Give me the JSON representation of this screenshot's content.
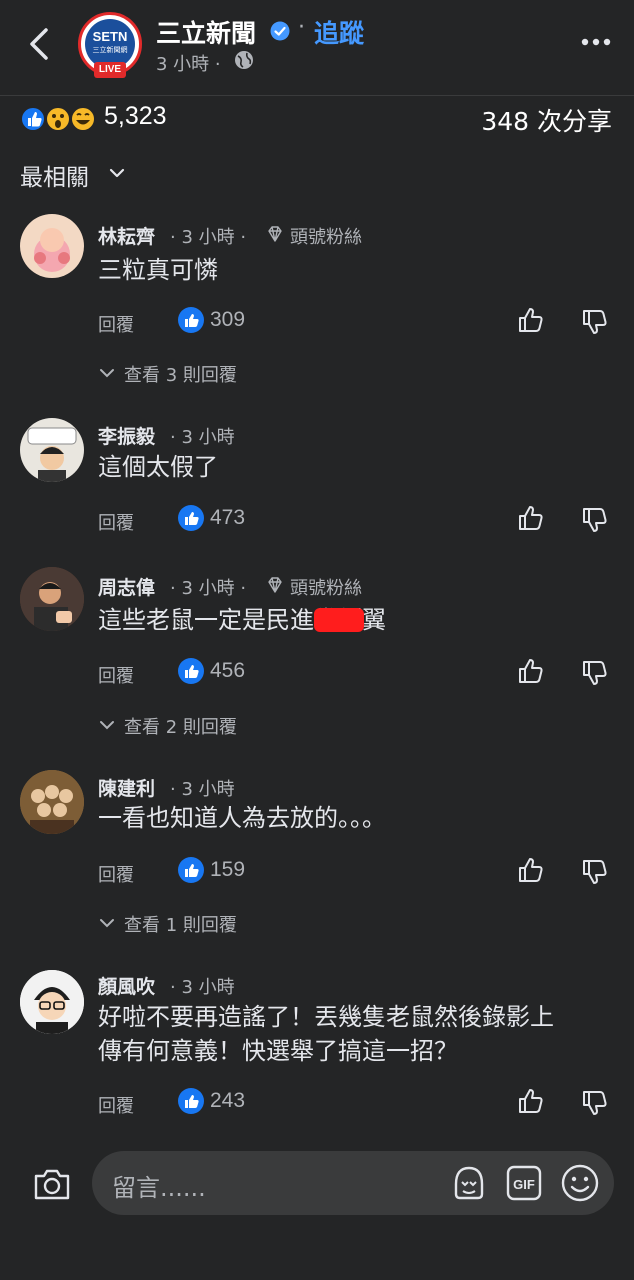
{
  "header": {
    "page_name": "三立新聞",
    "logo_text": "SETN",
    "logo_sub": "三立新聞網",
    "live_badge": "LIVE",
    "separator": "·",
    "follow_label": "追蹤",
    "post_time": "3 小時 ·"
  },
  "stats": {
    "reaction_count": "5,323",
    "share_count": "348 次分享"
  },
  "sort": {
    "label": "最相關"
  },
  "comments": [
    {
      "name": "林耘齊",
      "meta": "· 3 小時 ·",
      "badge": "頭號粉絲",
      "text": "三粒真可憐",
      "reply": "回覆",
      "likes": "309",
      "view_replies": "查看 3 則回覆"
    },
    {
      "name": "李振毅",
      "meta": "· 3 小時",
      "text": "這個太假了",
      "reply": "回覆",
      "likes": "473"
    },
    {
      "name": "周志偉",
      "meta": "· 3 小時 ·",
      "badge": "頭號粉絲",
      "text": "這些老鼠一定是民進黨側翼",
      "reply": "回覆",
      "likes": "456",
      "view_replies": "查看 2 則回覆"
    },
    {
      "name": "陳建利",
      "meta": "· 3 小時",
      "text": "一看也知道人為去放的。。。",
      "reply": "回覆",
      "likes": "159",
      "view_replies": "查看 1 則回覆"
    },
    {
      "name": "顏風吹",
      "meta": "· 3 小時",
      "text_line1": "好啦不要再造謠了！丟幾隻老鼠然後錄影上",
      "text_line2": "傳有何意義！快選舉了搞這一招？",
      "reply": "回覆",
      "likes": "243"
    }
  ],
  "composer": {
    "placeholder": "留言......",
    "gif_label": "GIF"
  },
  "colors": {
    "background": "#242526",
    "accent": "#4599ff",
    "like_blue": "#1877f2",
    "live_red": "#e12a2a"
  }
}
